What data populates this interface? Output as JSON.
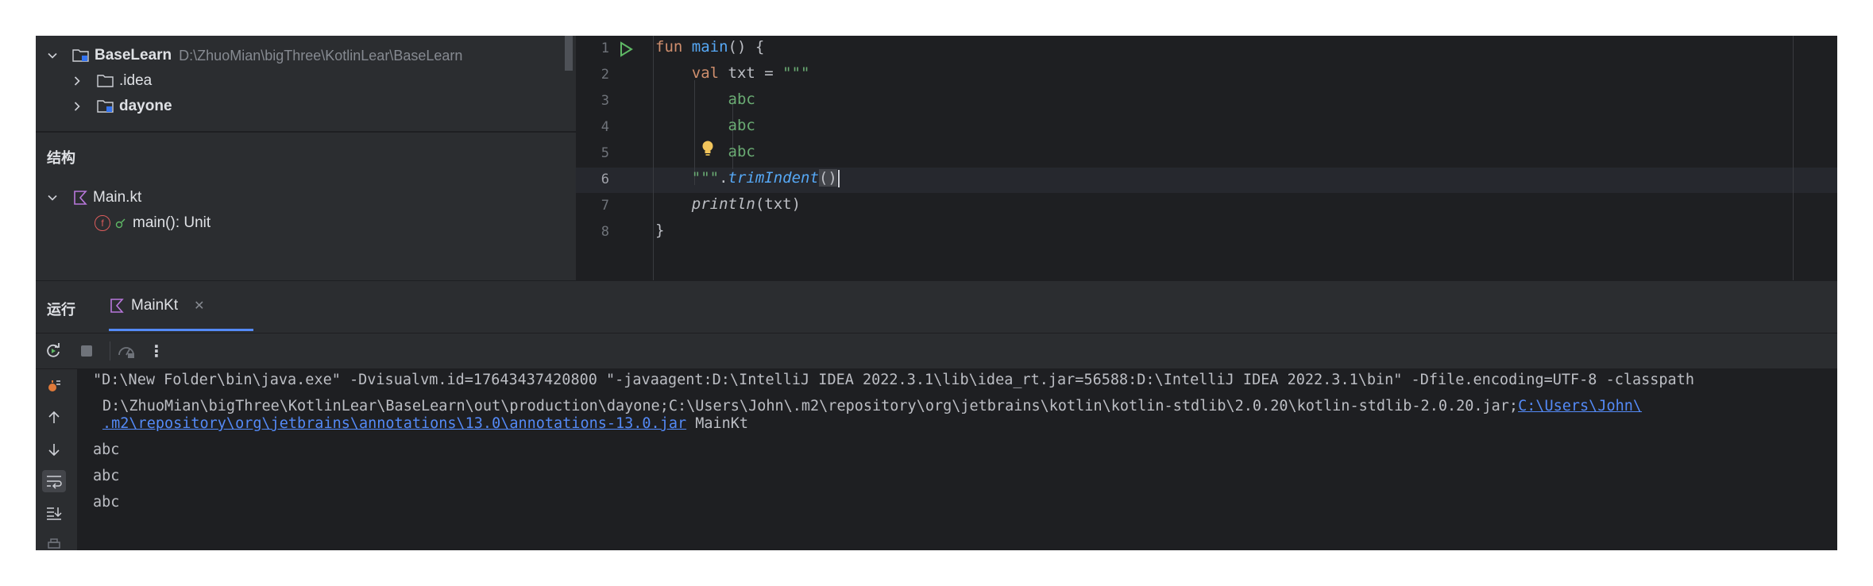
{
  "project_tree": {
    "root_name": "BaseLearn",
    "root_path": "D:\\ZhuoMian\\bigThree\\KotlinLear\\BaseLearn",
    "items": [
      {
        "label": ".idea"
      },
      {
        "label": "dayone"
      }
    ]
  },
  "structure": {
    "title": "结构",
    "file": "Main.kt",
    "member_badge": "f",
    "member": "main(): Unit"
  },
  "editor": {
    "line_numbers": [
      "1",
      "2",
      "3",
      "4",
      "5",
      "6",
      "7",
      "8"
    ],
    "code": {
      "l1_kw": "fun",
      "l1_fn": "main",
      "l1_rest": "() {",
      "l2_kw": "val",
      "l2_rest": " txt = ",
      "l2_str": "\"\"\"",
      "l3": "abc",
      "l4": "abc",
      "l5": "abc",
      "l6_str": "\"\"\"",
      "l6_dot": ".",
      "l6_fn": "trimIndent",
      "l6_paren": "()",
      "l7_fn": "println",
      "l7_rest": "(txt)",
      "l8": "}"
    }
  },
  "run_panel": {
    "label": "运行",
    "tab": "MainKt",
    "close_glyph": "✕",
    "toolbar_more": "⋮",
    "output": {
      "cmd_line1": "\"D:\\New Folder\\bin\\java.exe\" -Dvisualvm.id=17643437420800 \"-javaagent:D:\\IntelliJ IDEA 2022.3.1\\lib\\idea_rt.jar=56588:D:\\IntelliJ IDEA 2022.3.1\\bin\" -Dfile.encoding=UTF-8 -classpath",
      "cmd_line2_plain": "D:\\ZhuoMian\\bigThree\\KotlinLear\\BaseLearn\\out\\production\\dayone;C:\\Users\\John\\.m2\\repository\\org\\jetbrains\\kotlin\\kotlin-stdlib\\2.0.20\\kotlin-stdlib-2.0.20.jar;",
      "cmd_line2_link": "C:\\Users\\John\\",
      "cmd_line3_link": ".m2\\repository\\org\\jetbrains\\annotations\\13.0\\annotations-13.0.jar",
      "cmd_line3_rest": " MainKt",
      "results": [
        "abc",
        "abc",
        "abc"
      ]
    }
  },
  "colors": {
    "keyword": "#cf8e6d",
    "function": "#56a8f5",
    "string": "#6aab73",
    "link": "#548af7"
  }
}
